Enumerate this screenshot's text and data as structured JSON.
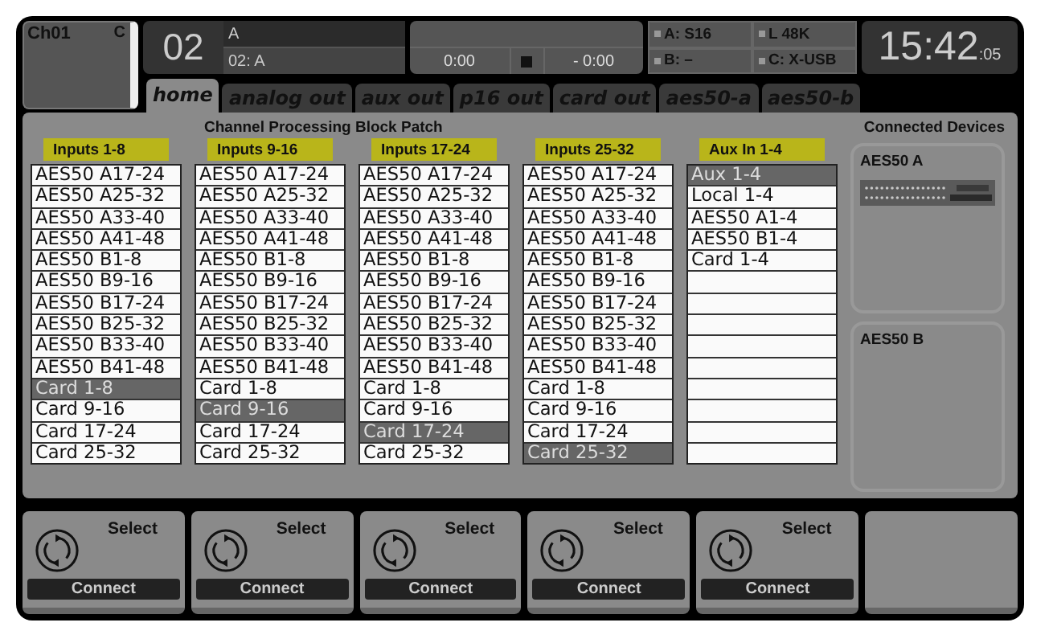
{
  "channel": {
    "label": "Ch01",
    "tag": "C"
  },
  "scene": {
    "number": "02",
    "name": "A",
    "detail": "02: A"
  },
  "transport": {
    "position": "0:00",
    "remaining": "- 0:00"
  },
  "status": [
    {
      "label": "A: S16"
    },
    {
      "label": "L  48K"
    },
    {
      "label": "B:  –"
    },
    {
      "label": "C: X-USB"
    }
  ],
  "clock": {
    "time": "15:42",
    "seconds": ":05"
  },
  "tabs": [
    {
      "label": "home",
      "selected": true
    },
    {
      "label": "analog out",
      "selected": false
    },
    {
      "label": "aux out",
      "selected": false
    },
    {
      "label": "p16 out",
      "selected": false
    },
    {
      "label": "card out",
      "selected": false
    },
    {
      "label": "aes50-a",
      "selected": false
    },
    {
      "label": "aes50-b",
      "selected": false
    }
  ],
  "panel": {
    "title": "Channel Processing Block Patch",
    "devices_title": "Connected Devices"
  },
  "columns": [
    {
      "header": "Inputs 1-8",
      "options": [
        {
          "label": "AES50 A17-24",
          "selected": false
        },
        {
          "label": "AES50 A25-32",
          "selected": false
        },
        {
          "label": "AES50 A33-40",
          "selected": false
        },
        {
          "label": "AES50 A41-48",
          "selected": false
        },
        {
          "label": "AES50 B1-8",
          "selected": false
        },
        {
          "label": "AES50 B9-16",
          "selected": false
        },
        {
          "label": "AES50 B17-24",
          "selected": false
        },
        {
          "label": "AES50 B25-32",
          "selected": false
        },
        {
          "label": "AES50 B33-40",
          "selected": false
        },
        {
          "label": "AES50 B41-48",
          "selected": false
        },
        {
          "label": "Card 1-8",
          "selected": true
        },
        {
          "label": "Card 9-16",
          "selected": false
        },
        {
          "label": "Card 17-24",
          "selected": false
        },
        {
          "label": "Card 25-32",
          "selected": false
        }
      ]
    },
    {
      "header": "Inputs 9-16",
      "options": [
        {
          "label": "AES50 A17-24",
          "selected": false
        },
        {
          "label": "AES50 A25-32",
          "selected": false
        },
        {
          "label": "AES50 A33-40",
          "selected": false
        },
        {
          "label": "AES50 A41-48",
          "selected": false
        },
        {
          "label": "AES50 B1-8",
          "selected": false
        },
        {
          "label": "AES50 B9-16",
          "selected": false
        },
        {
          "label": "AES50 B17-24",
          "selected": false
        },
        {
          "label": "AES50 B25-32",
          "selected": false
        },
        {
          "label": "AES50 B33-40",
          "selected": false
        },
        {
          "label": "AES50 B41-48",
          "selected": false
        },
        {
          "label": "Card 1-8",
          "selected": false
        },
        {
          "label": "Card 9-16",
          "selected": true
        },
        {
          "label": "Card 17-24",
          "selected": false
        },
        {
          "label": "Card 25-32",
          "selected": false
        }
      ]
    },
    {
      "header": "Inputs 17-24",
      "options": [
        {
          "label": "AES50 A17-24",
          "selected": false
        },
        {
          "label": "AES50 A25-32",
          "selected": false
        },
        {
          "label": "AES50 A33-40",
          "selected": false
        },
        {
          "label": "AES50 A41-48",
          "selected": false
        },
        {
          "label": "AES50 B1-8",
          "selected": false
        },
        {
          "label": "AES50 B9-16",
          "selected": false
        },
        {
          "label": "AES50 B17-24",
          "selected": false
        },
        {
          "label": "AES50 B25-32",
          "selected": false
        },
        {
          "label": "AES50 B33-40",
          "selected": false
        },
        {
          "label": "AES50 B41-48",
          "selected": false
        },
        {
          "label": "Card 1-8",
          "selected": false
        },
        {
          "label": "Card 9-16",
          "selected": false
        },
        {
          "label": "Card 17-24",
          "selected": true
        },
        {
          "label": "Card 25-32",
          "selected": false
        }
      ]
    },
    {
      "header": "Inputs 25-32",
      "options": [
        {
          "label": "AES50 A17-24",
          "selected": false
        },
        {
          "label": "AES50 A25-32",
          "selected": false
        },
        {
          "label": "AES50 A33-40",
          "selected": false
        },
        {
          "label": "AES50 A41-48",
          "selected": false
        },
        {
          "label": "AES50 B1-8",
          "selected": false
        },
        {
          "label": "AES50 B9-16",
          "selected": false
        },
        {
          "label": "AES50 B17-24",
          "selected": false
        },
        {
          "label": "AES50 B25-32",
          "selected": false
        },
        {
          "label": "AES50 B33-40",
          "selected": false
        },
        {
          "label": "AES50 B41-48",
          "selected": false
        },
        {
          "label": "Card 1-8",
          "selected": false
        },
        {
          "label": "Card 9-16",
          "selected": false
        },
        {
          "label": "Card 17-24",
          "selected": false
        },
        {
          "label": "Card 25-32",
          "selected": true
        }
      ]
    },
    {
      "header": "Aux In 1-4",
      "options": [
        {
          "label": "Aux 1-4",
          "selected": true
        },
        {
          "label": "Local 1-4",
          "selected": false
        },
        {
          "label": "AES50 A1-4",
          "selected": false
        },
        {
          "label": "AES50 B1-4",
          "selected": false
        },
        {
          "label": "Card 1-4",
          "selected": false
        }
      ]
    }
  ],
  "devices": [
    {
      "label": "AES50 A",
      "connected": true
    },
    {
      "label": "AES50 B",
      "connected": false
    }
  ],
  "encoders": [
    {
      "label": "Select",
      "button": "Connect"
    },
    {
      "label": "Select",
      "button": "Connect"
    },
    {
      "label": "Select",
      "button": "Connect"
    },
    {
      "label": "Select",
      "button": "Connect"
    },
    {
      "label": "Select",
      "button": "Connect"
    }
  ]
}
